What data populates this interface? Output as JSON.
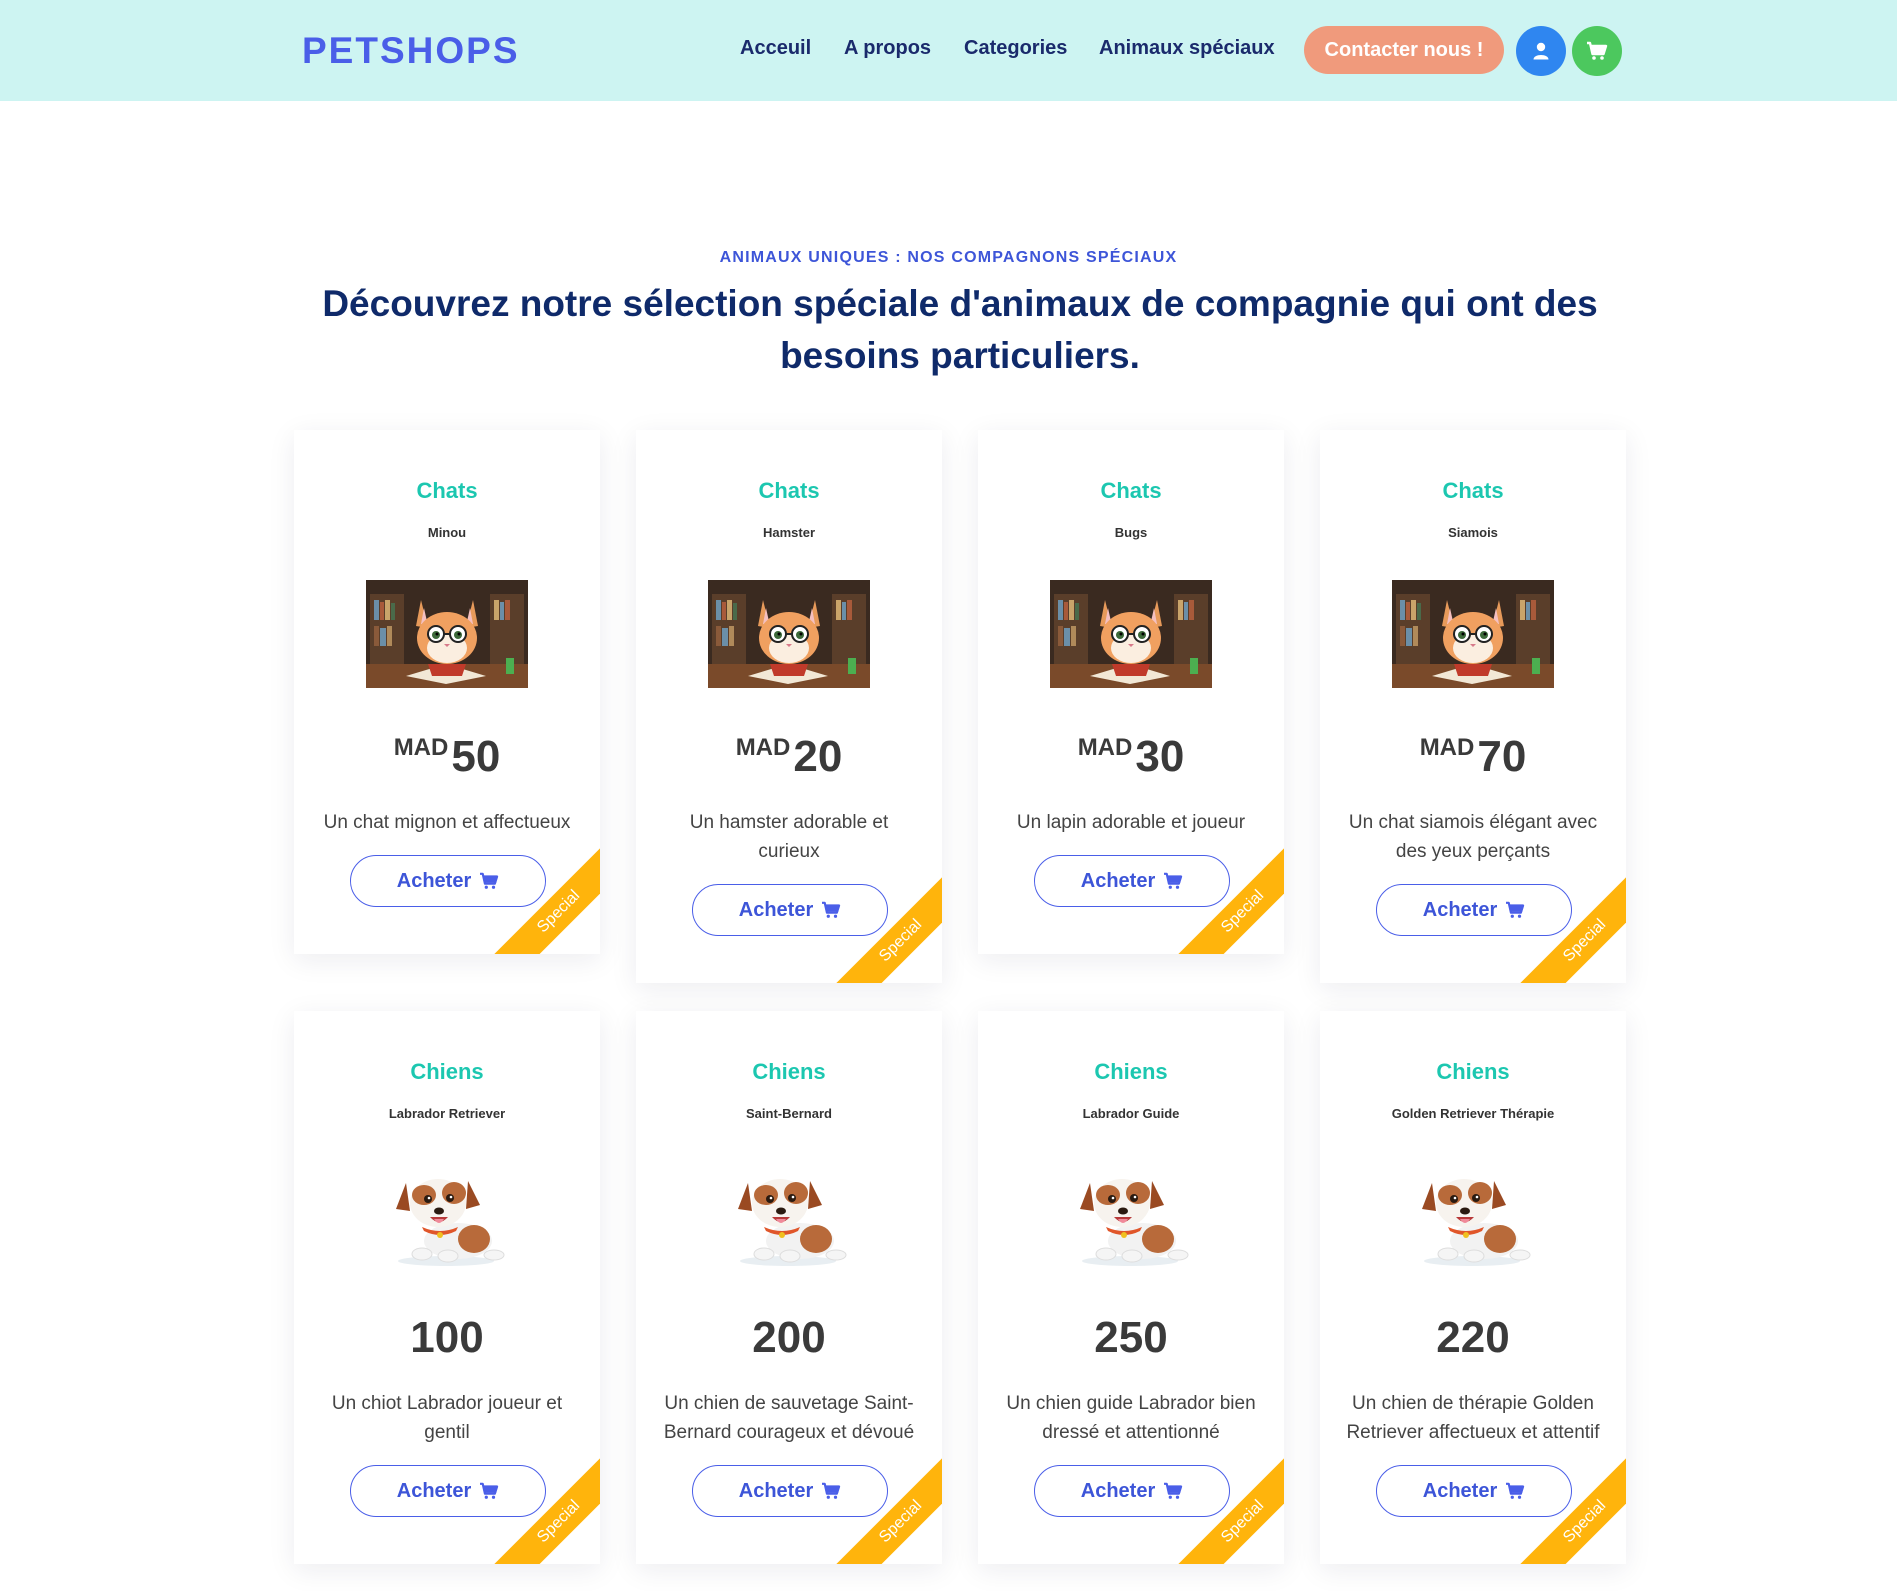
{
  "header": {
    "logo": "PETSHOPS",
    "nav": [
      "Acceuil",
      "A propos",
      "Categories",
      "Animaux spéciaux"
    ],
    "contact_label": "Contacter nous !",
    "colors": {
      "background": "#cdf4f2",
      "contact": "#f09a7c",
      "user": "#2f86f0",
      "cart": "#4cc85e"
    }
  },
  "section": {
    "subtitle": "ANIMAUX UNIQUES : NOS COMPAGNONS SPÉCIAUX",
    "title": "Découvrez notre sélection spéciale d'animaux de compagnie qui ont des besoins particuliers."
  },
  "buy_label": "Acheter",
  "ribbon_label": "Special",
  "cards": [
    {
      "category": "Chats",
      "name": "Minou",
      "currency": "MAD",
      "price": "50",
      "description": "Un chat mignon et affectueux",
      "image": "cat-illustration"
    },
    {
      "category": "Chats",
      "name": "Hamster",
      "currency": "MAD",
      "price": "20",
      "description": "Un hamster adorable et curieux",
      "image": "cat-illustration"
    },
    {
      "category": "Chats",
      "name": "Bugs",
      "currency": "MAD",
      "price": "30",
      "description": "Un lapin adorable et joueur",
      "image": "cat-illustration"
    },
    {
      "category": "Chats",
      "name": "Siamois",
      "currency": "MAD",
      "price": "70",
      "description": "Un chat siamois élégant avec des yeux perçants",
      "image": "cat-illustration"
    },
    {
      "category": "Chiens",
      "name": "Labrador Retriever",
      "currency": "",
      "price": "100",
      "description": "Un chiot Labrador joueur et gentil",
      "image": "dog-illustration"
    },
    {
      "category": "Chiens",
      "name": "Saint-Bernard",
      "currency": "",
      "price": "200",
      "description": "Un chien de sauvetage Saint-Bernard courageux et dévoué",
      "image": "dog-illustration"
    },
    {
      "category": "Chiens",
      "name": "Labrador Guide",
      "currency": "",
      "price": "250",
      "description": "Un chien guide Labrador bien dressé et attentionné",
      "image": "dog-illustration"
    },
    {
      "category": "Chiens",
      "name": "Golden Retriever Thérapie",
      "currency": "",
      "price": "220",
      "description": "Un chien de thérapie Golden Retriever affectueux et attentif",
      "image": "dog-illustration"
    }
  ]
}
